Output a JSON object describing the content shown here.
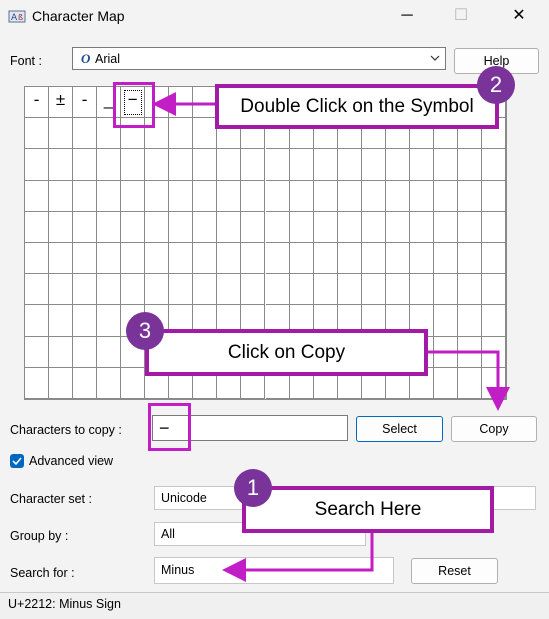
{
  "window": {
    "title": "Character Map",
    "minimize_glyph": "─",
    "maximize_glyph": "☐",
    "close_glyph": "✕"
  },
  "font": {
    "label": "Font :",
    "value": "Arial",
    "icon_glyph": "O",
    "help_label": "Help"
  },
  "grid": {
    "columns": 20,
    "rows": 10,
    "chars": [
      "-",
      "±",
      "-",
      "_",
      "−"
    ],
    "selected_index": 4
  },
  "copy": {
    "label": "Characters to copy :",
    "value": "−",
    "select_label": "Select",
    "copy_label": "Copy"
  },
  "advanced": {
    "label": "Advanced view",
    "checked": true
  },
  "charset": {
    "label": "Character set :",
    "value": "Unicode"
  },
  "groupby": {
    "label": "Group by :",
    "value": "All"
  },
  "search": {
    "label": "Search for :",
    "value": "Minus",
    "reset_label": "Reset"
  },
  "status": {
    "text": "U+2212: Minus Sign"
  },
  "annotations": {
    "step1": {
      "number": "1",
      "text": "Search Here"
    },
    "step2": {
      "number": "2",
      "text": "Double Click on the Symbol"
    },
    "step3": {
      "number": "3",
      "text": "Click on Copy"
    },
    "accent": "#a31aa6",
    "badge_color": "#7a3399"
  }
}
